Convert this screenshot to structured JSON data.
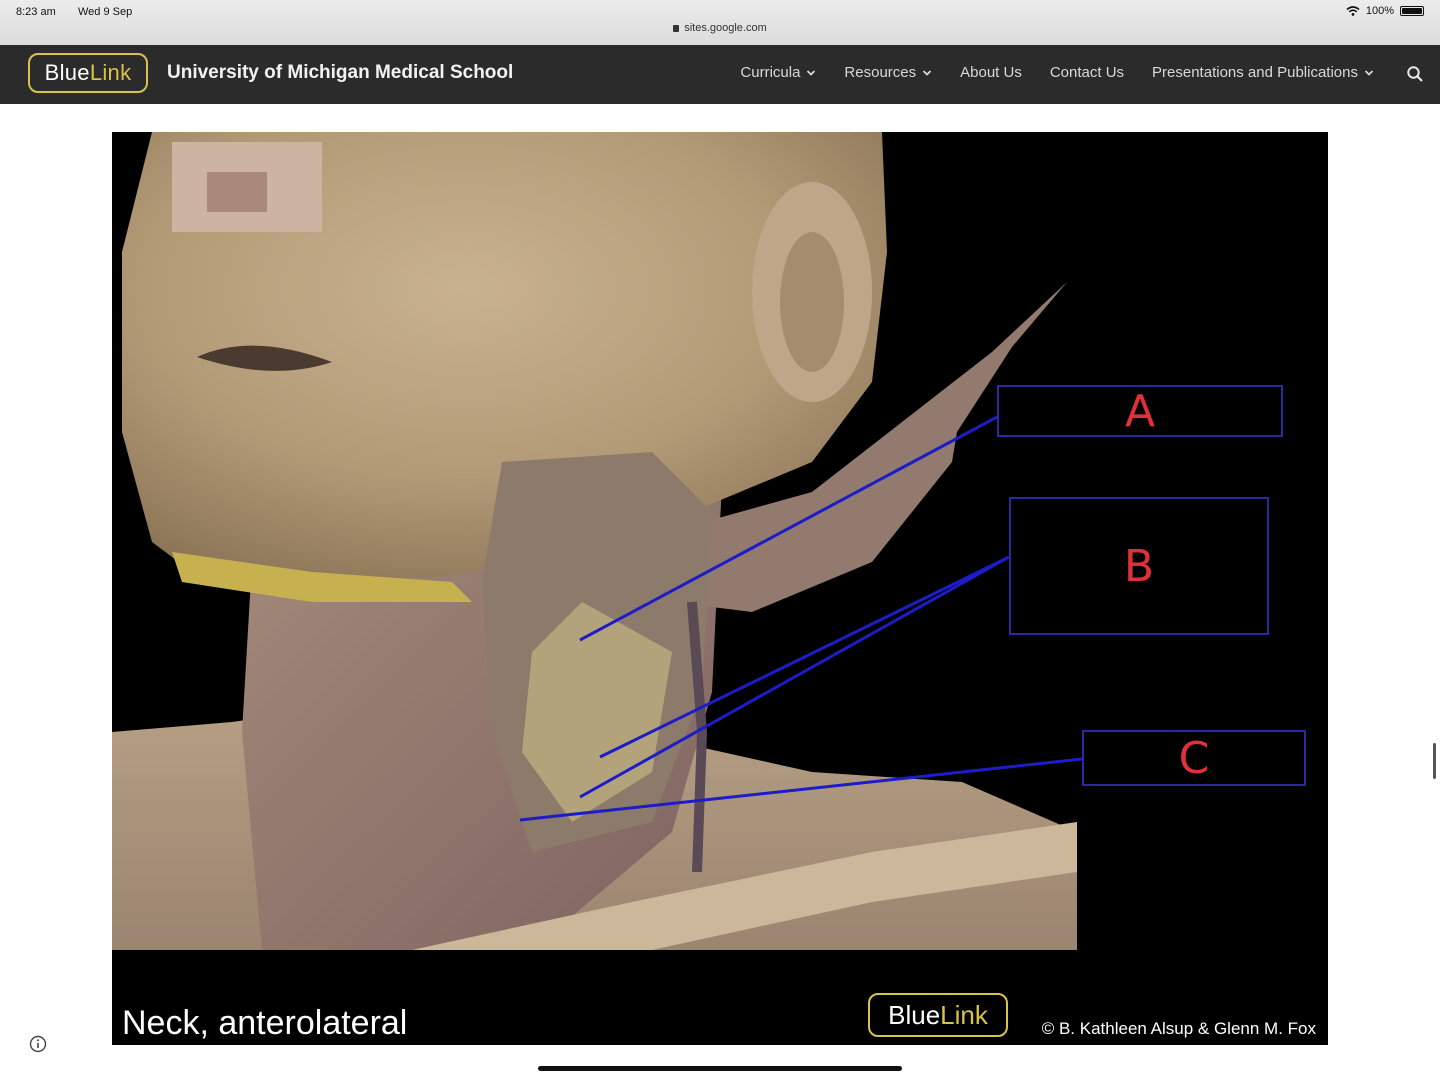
{
  "status_bar": {
    "time": "8:23 am",
    "date": "Wed 9 Sep",
    "url": "sites.google.com",
    "battery": "100%"
  },
  "site": {
    "logo_blue": "Blue",
    "logo_link": "Link",
    "school_name": "University of Michigan Medical School",
    "nav": {
      "curricula": "Curricula",
      "resources": "Resources",
      "about": "About Us",
      "contact": "Contact Us",
      "presentations": "Presentations and Publications"
    }
  },
  "figure": {
    "labels": {
      "a": "A",
      "b": "B",
      "c": "C"
    },
    "caption": "Neck, anterolateral",
    "logo_blue": "Blue",
    "logo_link": "Link",
    "credit": "© B. Kathleen Alsup & Glenn M. Fox"
  },
  "colors": {
    "nav_bg": "#2b2b2b",
    "logo_gold": "#d9c24a",
    "label_box_border": "#2a2aa0",
    "label_text": "#e0303a",
    "leader_line": "#1d1dc8"
  }
}
